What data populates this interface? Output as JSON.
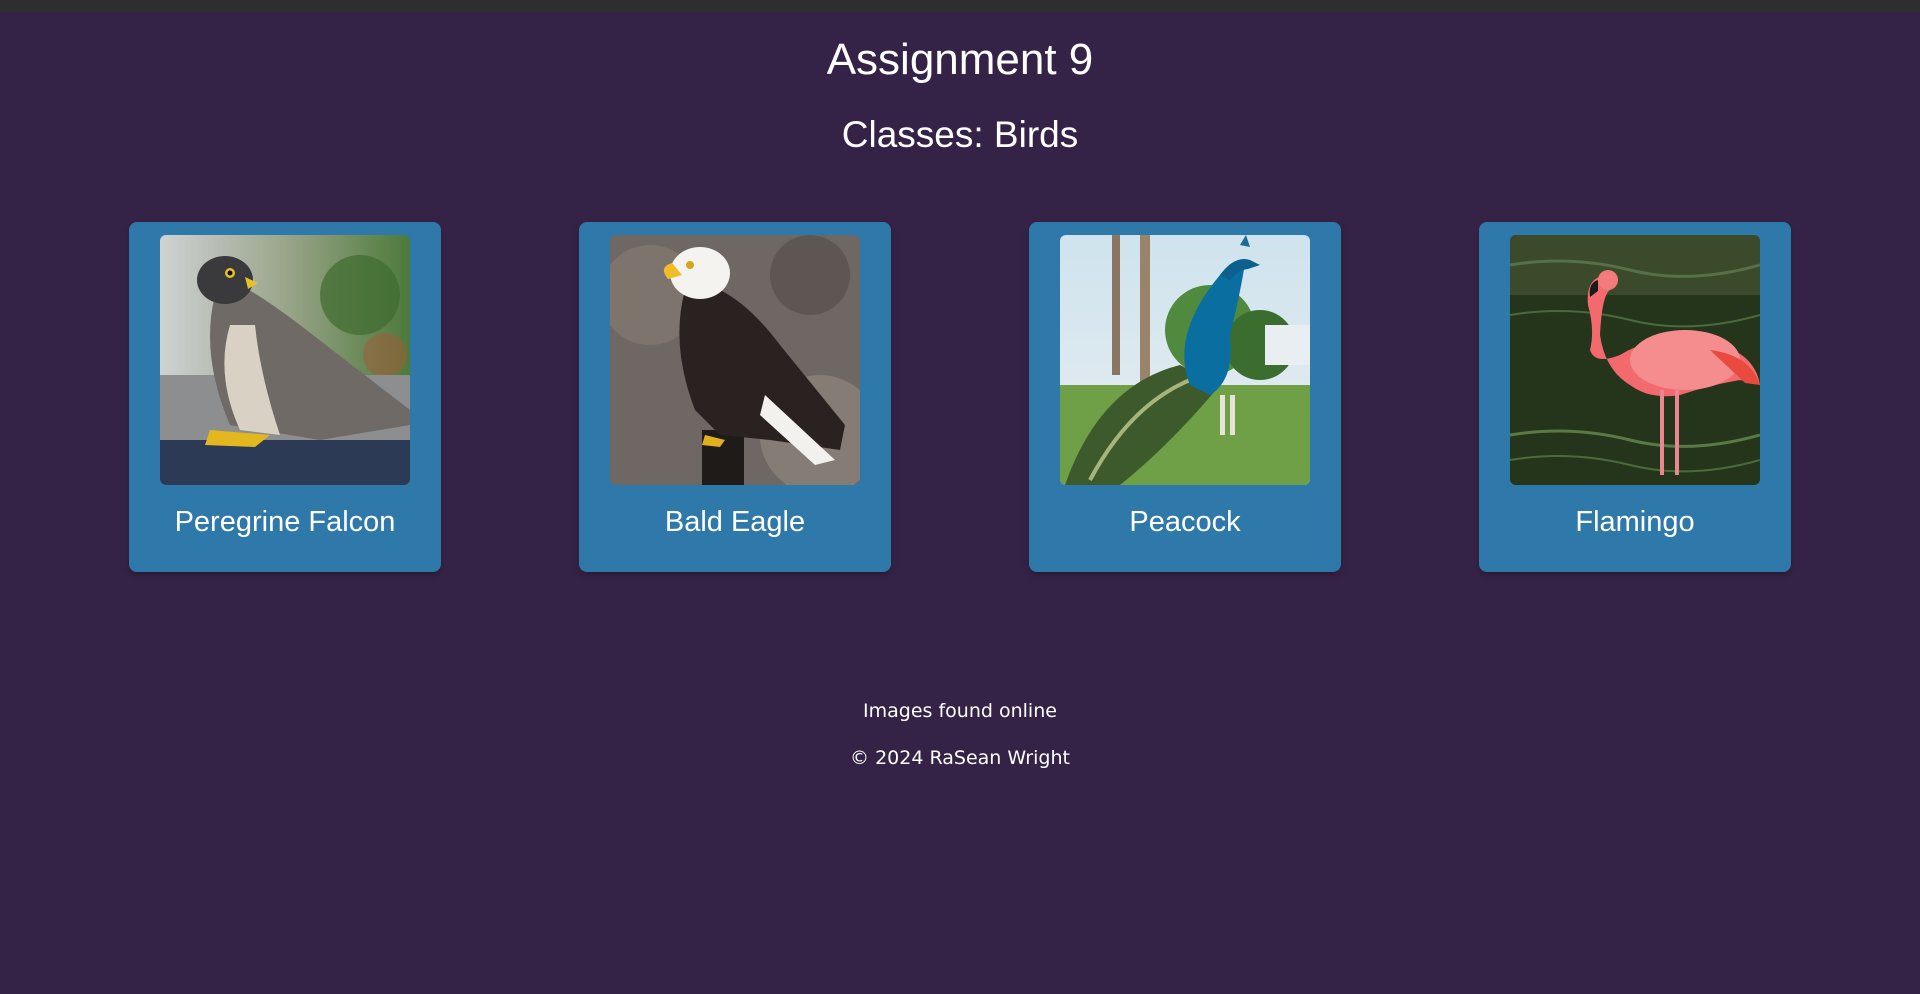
{
  "header": {
    "title": "Assignment 9",
    "subtitle": "Classes: Birds"
  },
  "cards": [
    {
      "label": "Peregrine Falcon",
      "image": "peregrine-falcon-photo"
    },
    {
      "label": "Bald Eagle",
      "image": "bald-eagle-photo"
    },
    {
      "label": "Peacock",
      "image": "peacock-photo"
    },
    {
      "label": "Flamingo",
      "image": "flamingo-photo"
    }
  ],
  "footer": {
    "note": "Images found online",
    "copyright": "© 2024 RaSean Wright"
  },
  "colors": {
    "background": "#352347",
    "card": "#2f78aa",
    "text": "#ffffff"
  }
}
